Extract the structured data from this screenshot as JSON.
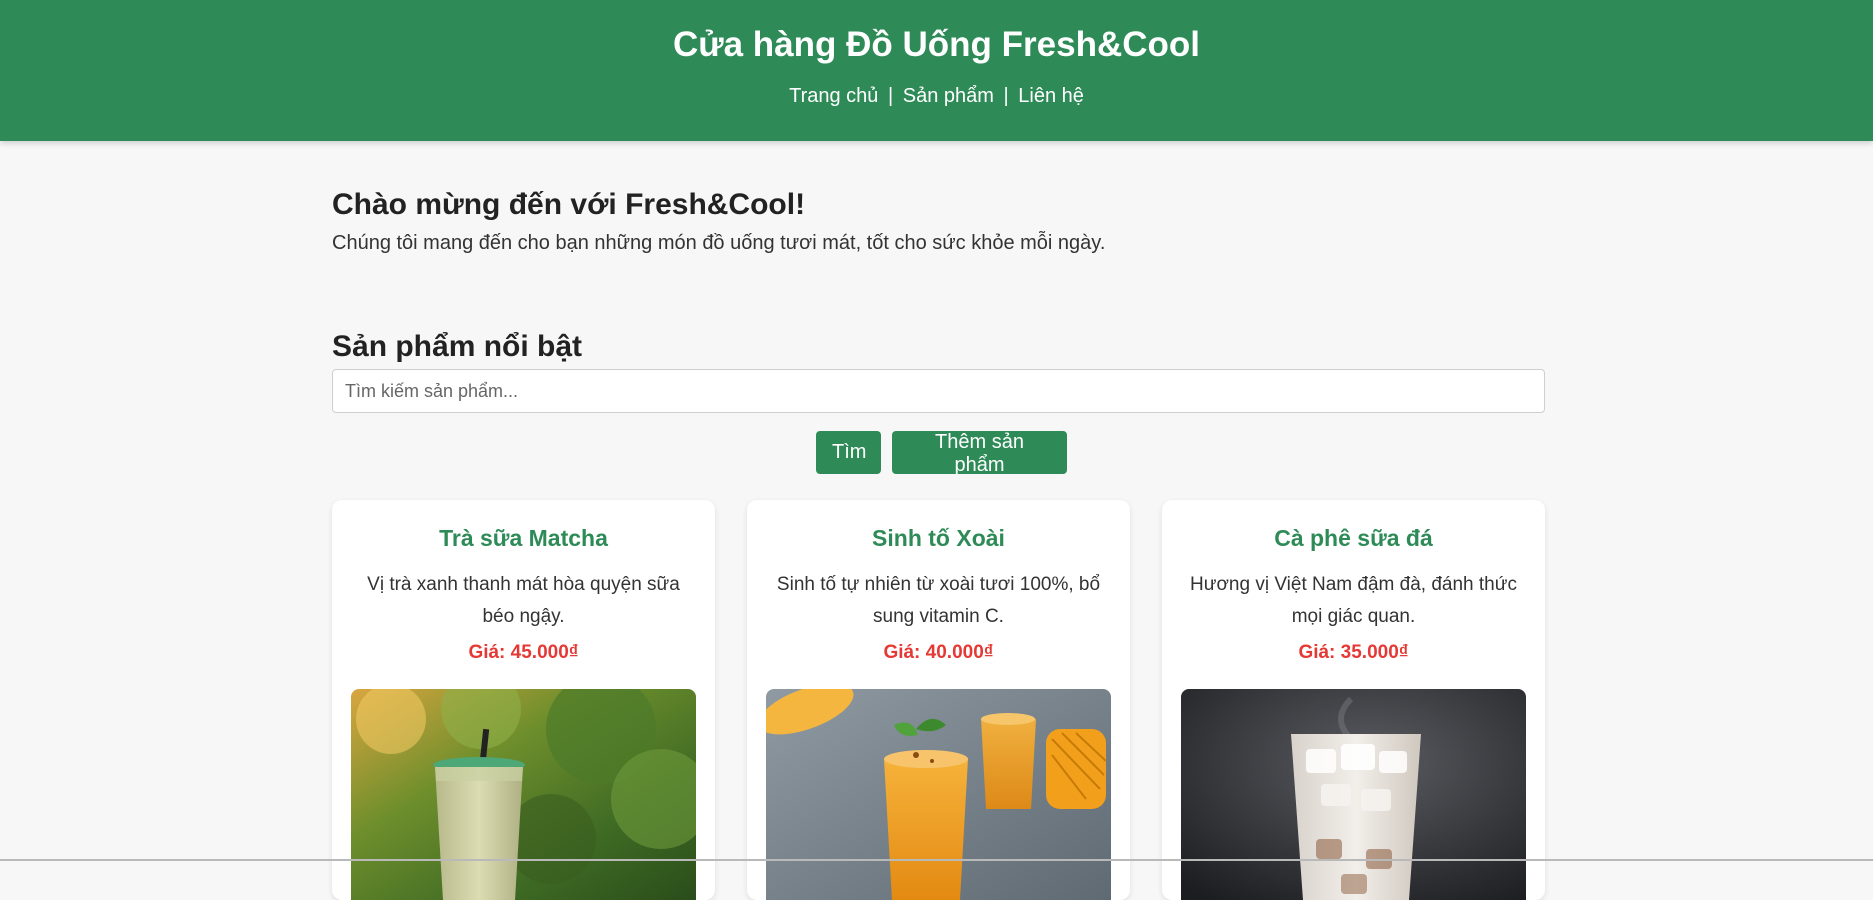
{
  "header": {
    "title": "Cửa hàng Đồ Uống Fresh&Cool",
    "nav": [
      {
        "label": "Trang chủ"
      },
      {
        "label": "Sản phẩm"
      },
      {
        "label": "Liên hệ"
      }
    ],
    "separator": "|"
  },
  "welcome": {
    "title": "Chào mừng đến với Fresh&Cool!",
    "text": "Chúng tôi mang đến cho bạn những món đồ uống tươi mát, tốt cho sức khỏe mỗi ngày."
  },
  "products_section": {
    "title": "Sản phẩm nổi bật",
    "search_placeholder": "Tìm kiếm sản phẩm...",
    "search_button": "Tìm",
    "add_button": "Thêm sản phẩm"
  },
  "products": [
    {
      "name": "Trà sữa Matcha",
      "description": "Vị trà xanh thanh mát hòa quyện sữa béo ngậy.",
      "price": "Giá: 45.000₫",
      "image_icon": "matcha-milk-tea-photo"
    },
    {
      "name": "Sinh tố Xoài",
      "description": "Sinh tố tự nhiên từ xoài tươi 100%, bổ sung vitamin C.",
      "price": "Giá: 40.000₫",
      "image_icon": "mango-smoothie-photo"
    },
    {
      "name": "Cà phê sữa đá",
      "description": "Hương vị Việt Nam đậm đà, đánh thức mọi giác quan.",
      "price": "Giá: 35.000₫",
      "image_icon": "iced-milk-coffee-photo"
    }
  ],
  "colors": {
    "brand_green": "#2e8b57",
    "price_red": "#e53935",
    "page_bg": "#f7f7f7"
  }
}
